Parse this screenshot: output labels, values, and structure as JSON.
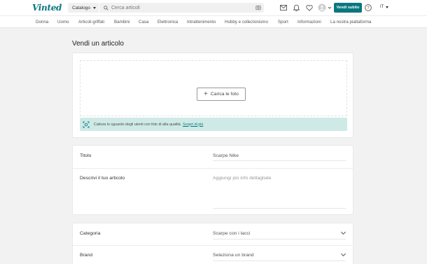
{
  "header": {
    "logo_text": "Vinted",
    "catalog_label": "Catalogo",
    "search_placeholder": "Cerca articoli",
    "sell_button_label": "Vendi subito",
    "language": "IT",
    "icons": [
      "mail-icon",
      "bell-icon",
      "heart-icon",
      "avatar",
      "help-icon"
    ]
  },
  "nav": {
    "categories": [
      "Donna",
      "Uomo",
      "Articoli griffati",
      "Bambini",
      "Casa",
      "Elettronica",
      "Intrattenimento",
      "Hobby e collezionismo",
      "Sport",
      "Informazioni",
      "La nostra piattaforma"
    ]
  },
  "page": {
    "title": "Vendi un articolo"
  },
  "upload": {
    "button_label": "Carica le foto",
    "tip_text": "Cattura lo sguardo degli utenti con foto di alta qualità.",
    "tip_link": "Scopri di più"
  },
  "details": {
    "title_label": "Titolo",
    "title_value": "Scarpe Nike",
    "description_label": "Descrivi il tuo articolo",
    "description_placeholder": "Aggiungi più info dettagliate"
  },
  "attributes": {
    "category_label": "Categoria",
    "category_value": "Scarpe con i lacci",
    "brand_label": "Brand",
    "brand_placeholder": "Seleziona un brand"
  },
  "colors": {
    "brand": "#09777f",
    "tip_background": "#cfeae6",
    "page_background": "#f2f2f2"
  }
}
